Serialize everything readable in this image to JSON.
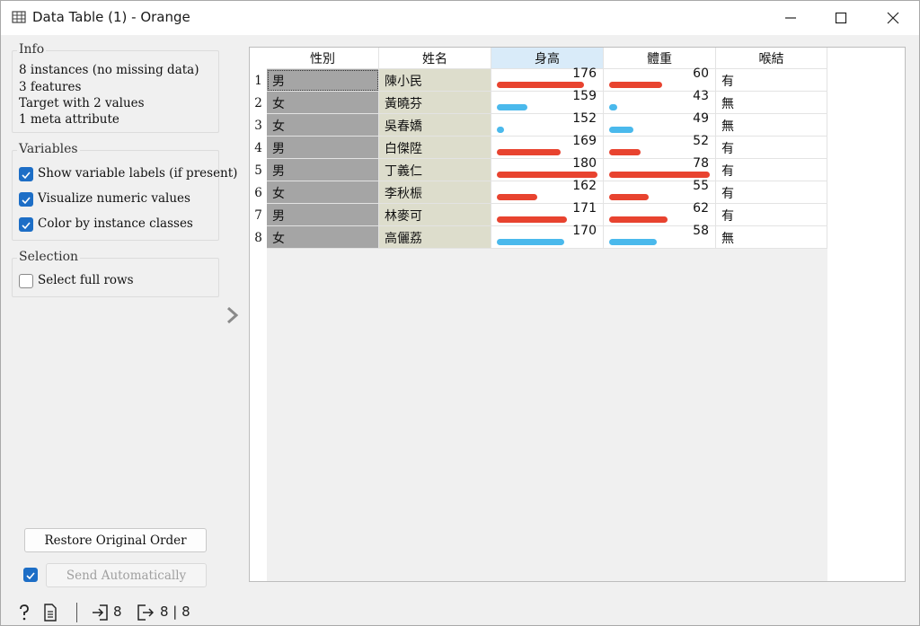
{
  "window": {
    "title": "Data Table (1) - Orange",
    "icon": "table-icon",
    "controls": [
      "minimize-icon",
      "maximize-icon",
      "close-icon"
    ]
  },
  "info": {
    "title": "Info",
    "lines": [
      "8 instances (no missing data)",
      "3 features",
      "Target with 2 values",
      "1 meta attribute"
    ]
  },
  "variables": {
    "title": "Variables",
    "options": [
      {
        "label": "Show variable labels (if present)",
        "checked": true
      },
      {
        "label": "Visualize numeric values",
        "checked": true
      },
      {
        "label": "Color by instance classes",
        "checked": true
      }
    ]
  },
  "selection": {
    "title": "Selection",
    "options": [
      {
        "label": "Select full rows",
        "checked": false
      }
    ]
  },
  "buttons": {
    "restore": "Restore Original Order",
    "send": "Send Automatically",
    "send_checked": true
  },
  "table": {
    "columns": [
      "性別",
      "姓名",
      "身高",
      "體重",
      "喉結"
    ],
    "sorted_column": "身高",
    "rows": [
      {
        "num": "1",
        "sex": "男",
        "name": "陳小民",
        "height": "176",
        "weight": "60",
        "adam": "有"
      },
      {
        "num": "2",
        "sex": "女",
        "name": "黃曉芬",
        "height": "159",
        "weight": "43",
        "adam": "無"
      },
      {
        "num": "3",
        "sex": "女",
        "name": "吳春嬌",
        "height": "152",
        "weight": "49",
        "adam": "無"
      },
      {
        "num": "4",
        "sex": "男",
        "name": "白傑陞",
        "height": "169",
        "weight": "52",
        "adam": "有"
      },
      {
        "num": "5",
        "sex": "男",
        "name": "丁義仁",
        "height": "180",
        "weight": "78",
        "adam": "有"
      },
      {
        "num": "6",
        "sex": "女",
        "name": "李秋桭",
        "height": "162",
        "weight": "55",
        "adam": "有"
      },
      {
        "num": "7",
        "sex": "男",
        "name": "林麥可",
        "height": "171",
        "weight": "62",
        "adam": "有"
      },
      {
        "num": "8",
        "sex": "女",
        "name": "高儷荔",
        "height": "170",
        "weight": "58",
        "adam": "無"
      }
    ],
    "bar_colors": {
      "有": "#e8432f",
      "無": "#4ab9ec"
    }
  },
  "statusbar": {
    "help_icon": "help-icon",
    "report_icon": "report-icon",
    "input_icon": "input-icon",
    "input_count": "8",
    "output_icon": "output-icon",
    "output_count": "8 | 8"
  }
}
